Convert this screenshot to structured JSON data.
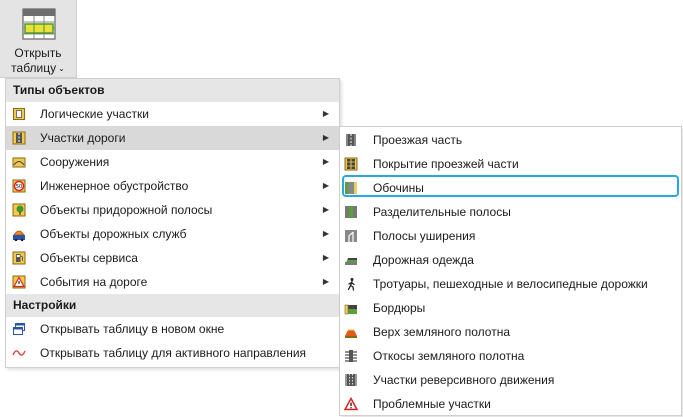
{
  "ribbon": {
    "open_table_line1": "Открыть",
    "open_table_line2": "таблицу",
    "chevron": "⌄"
  },
  "menu": {
    "object_types_header": "Типы объектов",
    "items": [
      {
        "label": "Логические участки",
        "icon": "logical-sections-icon",
        "submenu": true
      },
      {
        "label": "Участки дороги",
        "icon": "road-sections-icon",
        "submenu": true,
        "highlighted": true
      },
      {
        "label": "Сооружения",
        "icon": "structures-icon",
        "submenu": true
      },
      {
        "label": "Инженерное обустройство",
        "icon": "speed-sign-icon",
        "submenu": true
      },
      {
        "label": "Объекты придорожной полосы",
        "icon": "tree-icon",
        "submenu": true
      },
      {
        "label": "Объекты дорожных служб",
        "icon": "road-service-icon",
        "submenu": true
      },
      {
        "label": "Объекты сервиса",
        "icon": "fuel-icon",
        "submenu": true
      },
      {
        "label": "События на дороге",
        "icon": "warning-sign-icon",
        "submenu": true
      }
    ],
    "settings_header": "Настройки",
    "settings": [
      {
        "label": "Открывать таблицу в новом окне",
        "icon": "new-window-icon"
      },
      {
        "label": "Открывать таблицу для активного направления",
        "icon": "direction-wave-icon"
      }
    ]
  },
  "submenu": {
    "items": [
      {
        "label": "Проезжая часть",
        "icon": "carriageway-icon"
      },
      {
        "label": "Покрытие проезжей части",
        "icon": "pavement-icon"
      },
      {
        "label": "Обочины",
        "icon": "shoulders-icon",
        "focused": true
      },
      {
        "label": "Разделительные полосы",
        "icon": "median-icon"
      },
      {
        "label": "Полосы уширения",
        "icon": "widening-lanes-icon"
      },
      {
        "label": "Дорожная одежда",
        "icon": "road-layers-icon"
      },
      {
        "label": "Тротуары, пешеходные и велосипедные дорожки",
        "icon": "pedestrian-icon"
      },
      {
        "label": "Бордюры",
        "icon": "curbs-icon"
      },
      {
        "label": "Верх земляного полотна",
        "icon": "subgrade-top-icon"
      },
      {
        "label": "Откосы земляного полотна",
        "icon": "slopes-icon"
      },
      {
        "label": "Участки реверсивного движения",
        "icon": "reversible-lanes-icon"
      },
      {
        "label": "Проблемные участки",
        "icon": "problem-sections-icon"
      }
    ]
  },
  "colors": {
    "accent_outline": "#29a9e0",
    "header_bg": "#e6e6e6",
    "highlight_bg": "#d9d9d9",
    "ribbon_bg": "#e4e4e4"
  }
}
